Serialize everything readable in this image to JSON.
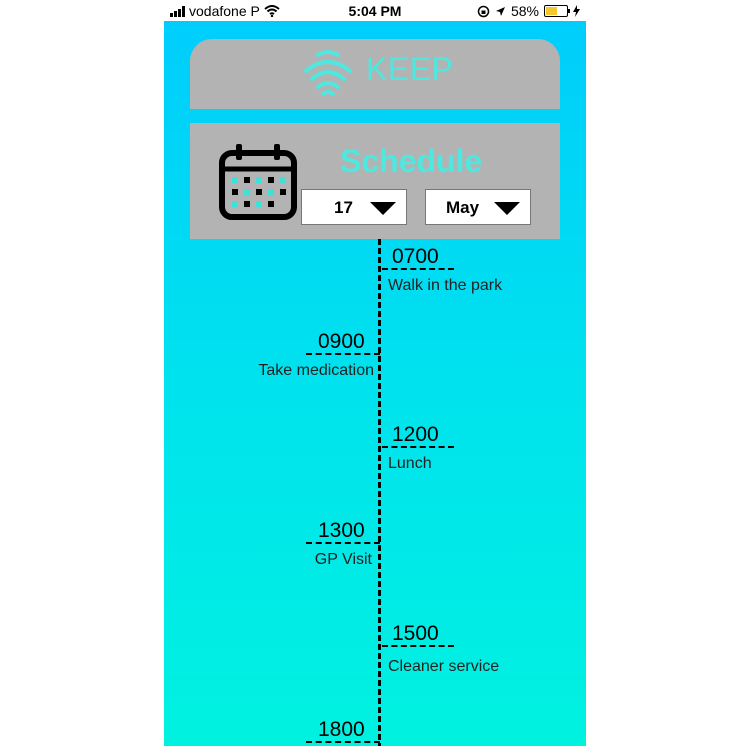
{
  "status": {
    "carrier": "vodafone P",
    "time": "5:04 PM",
    "battery": "58%",
    "battery_level": 0.58
  },
  "app": {
    "logo_text": "KEEP"
  },
  "schedule": {
    "title": "Schedule",
    "day_value": "17",
    "month_value": "May"
  },
  "events": [
    {
      "time": "0700",
      "label": "Walk in the park",
      "side": "right"
    },
    {
      "time": "0900",
      "label": "Take medication",
      "side": "left"
    },
    {
      "time": "1200",
      "label": "Lunch",
      "side": "right"
    },
    {
      "time": "1300",
      "label": "GP Visit",
      "side": "left"
    },
    {
      "time": "1500",
      "label": "Cleaner service",
      "side": "right"
    },
    {
      "time": "1800",
      "label": "",
      "side": "left"
    }
  ]
}
